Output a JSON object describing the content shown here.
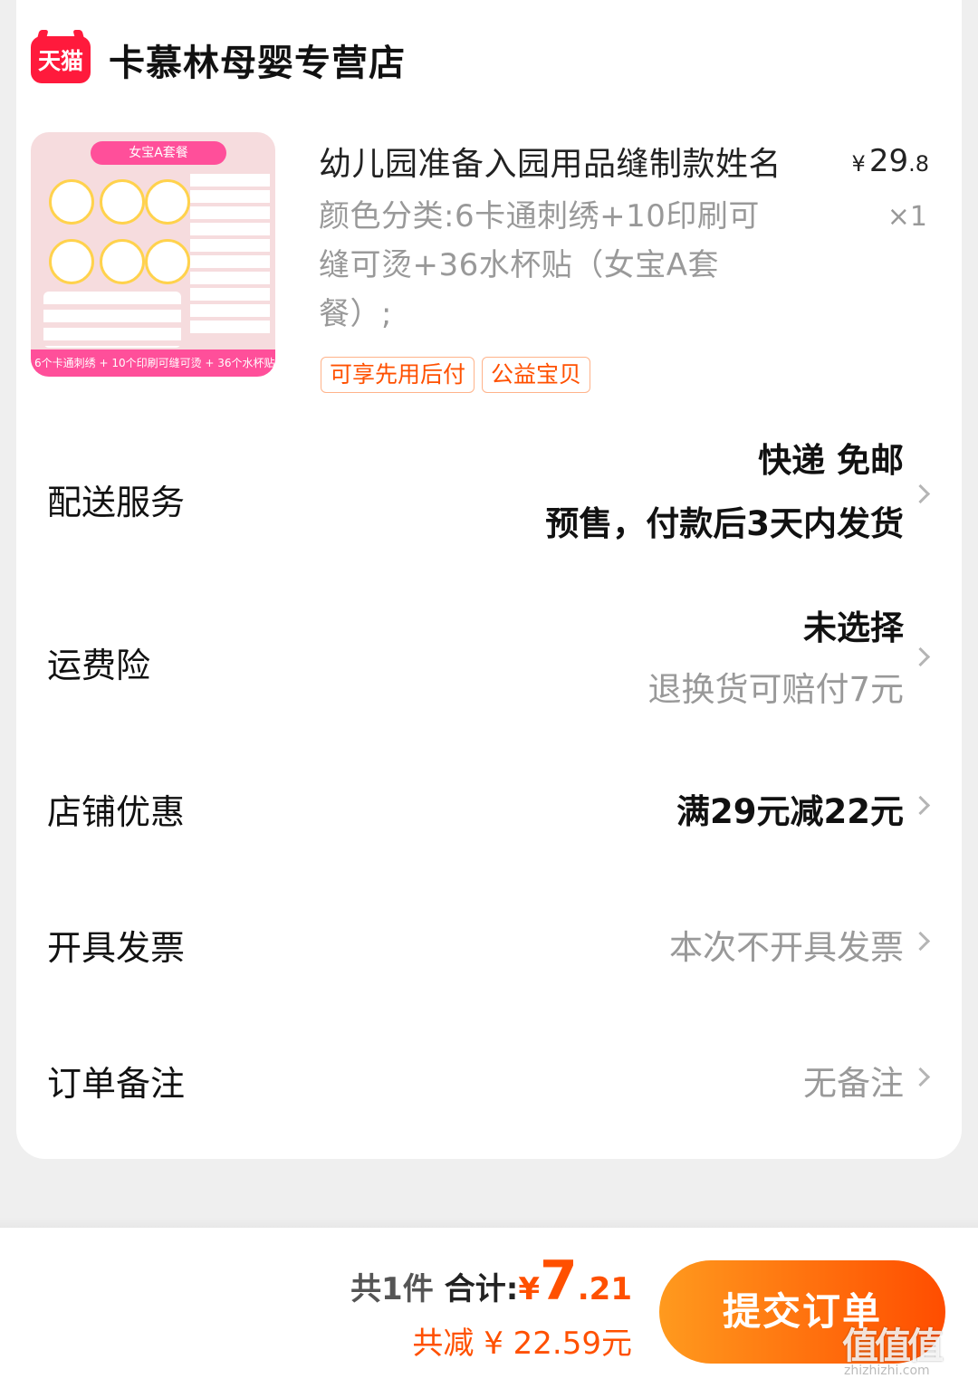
{
  "store": {
    "logo_text": "天猫",
    "name": "卡慕林母婴专营店"
  },
  "product": {
    "image_banner": "女宝A套餐",
    "image_caption": "6个卡通刺绣 + 10个印刷可缝可烫 + 36个水杯贴",
    "title": "幼儿园准备入园用品缝制款姓名",
    "price_symbol": "¥",
    "price_int": "29",
    "price_dec": ".8",
    "quantity": "×1",
    "spec": "颜色分类:6卡通刺绣+10印刷可缝可烫+36水杯贴（女宝A套餐）;",
    "tags": [
      "可享先用后付",
      "公益宝贝"
    ]
  },
  "rows": {
    "delivery": {
      "label": "配送服务",
      "line1": "快递 免邮",
      "line2": "预售，付款后3天内发货"
    },
    "insurance": {
      "label": "运费险",
      "line1": "未选择",
      "line2": "退换货可赔付7元"
    },
    "discount": {
      "label": "店铺优惠",
      "value": "满29元减22元"
    },
    "invoice": {
      "label": "开具发票",
      "value": "本次不开具发票"
    },
    "remark": {
      "label": "订单备注",
      "value": "无备注"
    }
  },
  "footer": {
    "count_text": "共1件",
    "total_label": "合计:",
    "total_symbol": "¥",
    "total_int": "7",
    "total_dec": ".21",
    "saved_text": "共减 ¥ 22.59元",
    "submit_label": "提交订单",
    "watermark": "值值值",
    "watermark_url": "zhizhizhi.com"
  },
  "colors": {
    "accent": "#ff5000",
    "tmall_red": "#ff1a3c",
    "button_start": "#ff9a1e",
    "button_end": "#ff4d00"
  }
}
